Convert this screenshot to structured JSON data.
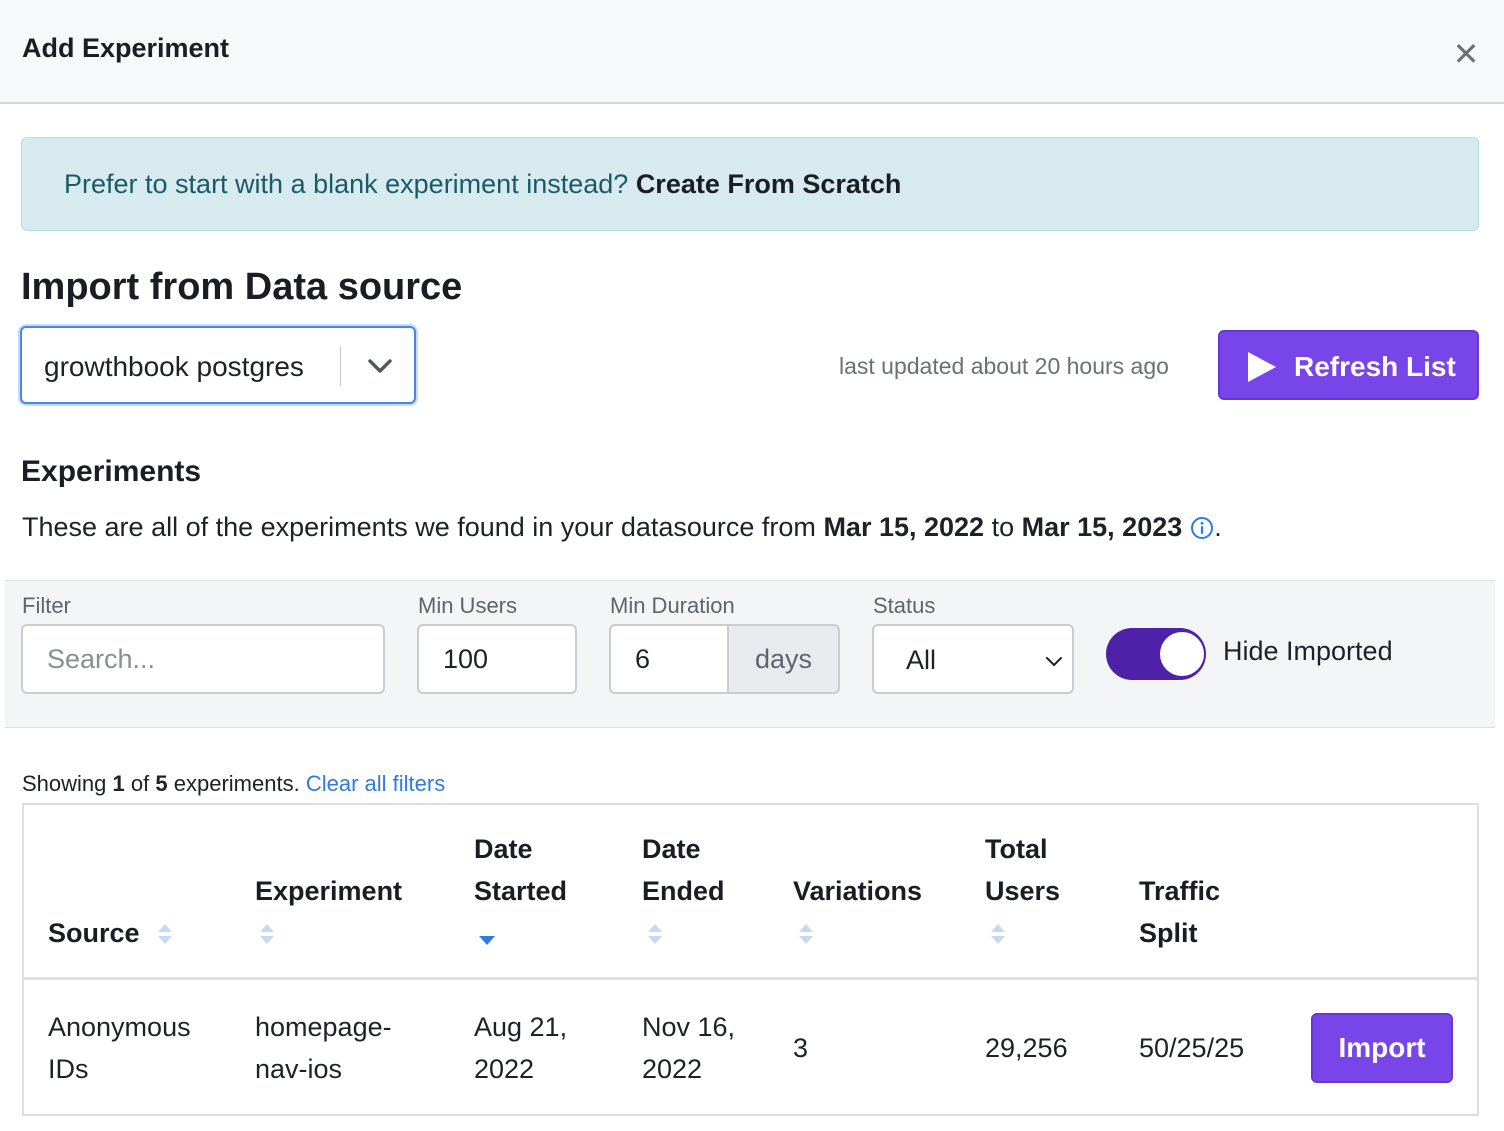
{
  "modal": {
    "title": "Add Experiment",
    "close_icon": "close-icon"
  },
  "alert": {
    "text": "Prefer to start with a blank experiment instead?",
    "link": "Create From Scratch"
  },
  "import": {
    "heading": "Import from Data source",
    "datasource_value": "growthbook postgres",
    "last_updated": "last updated about 20 hours ago",
    "refresh_label": "Refresh List"
  },
  "experiments": {
    "heading": "Experiments",
    "desc_prefix": "These are all of the experiments we found in your datasource from",
    "date_from": "Mar 15, 2022",
    "desc_mid": "to",
    "date_to": "Mar 15, 2023",
    "desc_suffix": "."
  },
  "filters": {
    "filter_label": "Filter",
    "filter_placeholder": "Search...",
    "min_users_label": "Min Users",
    "min_users_value": "100",
    "min_duration_label": "Min Duration",
    "min_duration_value": "6",
    "duration_unit": "days",
    "status_label": "Status",
    "status_value": "All",
    "hide_imported_label": "Hide Imported",
    "hide_imported_on": true
  },
  "results": {
    "showing_prefix": "Showing",
    "shown": "1",
    "of": "of",
    "total": "5",
    "suffix": "experiments.",
    "clear_link": "Clear all filters"
  },
  "table": {
    "headers": {
      "source": "Source",
      "experiment": "Experiment",
      "date_started_1": "Date",
      "date_started_2": "Started",
      "date_ended_1": "Date",
      "date_ended_2": "Ended",
      "variations": "Variations",
      "total_users_1": "Total",
      "total_users_2": "Users",
      "traffic_split_1": "Traffic",
      "traffic_split_2": "Split"
    },
    "rows": [
      {
        "source_1": "Anonymous",
        "source_2": "IDs",
        "experiment_1": "homepage-",
        "experiment_2": "nav-ios",
        "started_1": "Aug 21,",
        "started_2": "2022",
        "ended_1": "Nov 16,",
        "ended_2": "2022",
        "variations": "3",
        "total_users": "29,256",
        "traffic_split": "50/25/25",
        "action": "Import"
      }
    ]
  },
  "colors": {
    "primary": "#7845e8",
    "toggle_on": "#4e21a8",
    "link": "#2f7ae5",
    "alert_bg": "#d6eaef"
  }
}
